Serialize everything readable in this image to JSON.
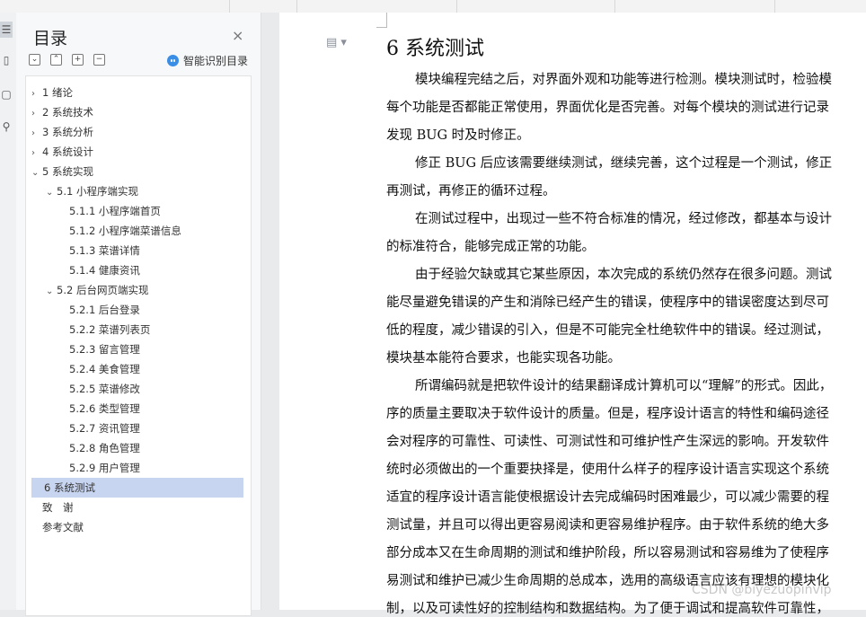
{
  "panel": {
    "title": "目录",
    "close_glyph": "×",
    "smart_label": "智能识别目录",
    "tools": [
      {
        "name": "collapse-all-button",
        "glyph": "⌄"
      },
      {
        "name": "expand-all-button",
        "glyph": "⌃"
      },
      {
        "name": "add-heading-button",
        "glyph": "+"
      },
      {
        "name": "remove-heading-button",
        "glyph": "−"
      }
    ]
  },
  "toc": [
    {
      "label": "1 绪论",
      "level": 0,
      "arrow": "›"
    },
    {
      "label": "2 系统技术",
      "level": 0,
      "arrow": "›"
    },
    {
      "label": "3 系统分析",
      "level": 0,
      "arrow": "›"
    },
    {
      "label": "4 系统设计",
      "level": 0,
      "arrow": "›"
    },
    {
      "label": "5 系统实现",
      "level": 0,
      "arrow": "⌄"
    },
    {
      "label": "5.1 小程序端实现",
      "level": 1,
      "arrow": "⌄"
    },
    {
      "label": "5.1.1 小程序端首页",
      "level": 2,
      "arrow": ""
    },
    {
      "label": "5.1.2 小程序端菜谱信息",
      "level": 2,
      "arrow": ""
    },
    {
      "label": "5.1.3 菜谱详情",
      "level": 2,
      "arrow": ""
    },
    {
      "label": "5.1.4 健康资讯",
      "level": 2,
      "arrow": ""
    },
    {
      "label": "5.2 后台网页端实现",
      "level": 1,
      "arrow": "⌄"
    },
    {
      "label": "5.2.1 后台登录",
      "level": 2,
      "arrow": ""
    },
    {
      "label": "5.2.2 菜谱列表页",
      "level": 2,
      "arrow": ""
    },
    {
      "label": "5.2.3 留言管理",
      "level": 2,
      "arrow": ""
    },
    {
      "label": "5.2.4 美食管理",
      "level": 2,
      "arrow": ""
    },
    {
      "label": "5.2.5 菜谱修改",
      "level": 2,
      "arrow": ""
    },
    {
      "label": "5.2.6 类型管理",
      "level": 2,
      "arrow": ""
    },
    {
      "label": "5.2.7 资讯管理",
      "level": 2,
      "arrow": ""
    },
    {
      "label": "5.2.8 角色管理",
      "level": 2,
      "arrow": ""
    },
    {
      "label": "5.2.9 用户管理",
      "level": 2,
      "arrow": ""
    },
    {
      "label": "6 系统测试",
      "level": 0,
      "arrow": "",
      "selected": true
    },
    {
      "label": "致　谢",
      "level": 0,
      "arrow": ""
    },
    {
      "label": "参考文献",
      "level": 0,
      "arrow": ""
    }
  ],
  "document": {
    "heading": "6 系统测试",
    "lines": [
      {
        "text": "模块编程完结之后，对界面外观和功能等进行检测。模块测试时，检验模",
        "indent": true
      },
      {
        "text": "每个功能是否都能正常使用，界面优化是否完善。对每个模块的测试进行记录",
        "indent": false
      },
      {
        "text": "发现 BUG 时及时修正。",
        "indent": false
      },
      {
        "text": "修正 BUG 后应该需要继续测试，继续完善，这个过程是一个测试，修正",
        "indent": true
      },
      {
        "text": "再测试，再修正的循环过程。",
        "indent": false
      },
      {
        "text": "在测试过程中，出现过一些不符合标准的情况，经过修改，都基本与设计",
        "indent": true
      },
      {
        "text": "的标准符合，能够完成正常的功能。",
        "indent": false
      },
      {
        "text": "由于经验欠缺或其它某些原因，本次完成的系统仍然存在很多问题。测试",
        "indent": true
      },
      {
        "text": "能尽量避免错误的产生和消除已经产生的错误，使程序中的错误密度达到尽可",
        "indent": false
      },
      {
        "text": "低的程度，减少错误的引入，但是不可能完全杜绝软件中的错误。经过测试，",
        "indent": false
      },
      {
        "text": "模块基本能符合要求，也能实现各功能。",
        "indent": false
      },
      {
        "text": "所谓编码就是把软件设计的结果翻译成计算机可以“理解”的形式。因此，",
        "indent": true
      },
      {
        "text": "序的质量主要取决于软件设计的质量。但是，程序设计语言的特性和编码途径",
        "indent": false
      },
      {
        "text": "会对程序的可靠性、可读性、可测试性和可维护性产生深远的影响。开发软件",
        "indent": false
      },
      {
        "text": "统时必须做出的一个重要抉择是，使用什么样子的程序设计语言实现这个系统",
        "indent": false
      },
      {
        "text": "适宜的程序设计语言能使根据设计去完成编码时困难最少，可以减少需要的程",
        "indent": false
      },
      {
        "text": "测试量，并且可以得出更容易阅读和更容易维护程序。由于软件系统的绝大多",
        "indent": false
      },
      {
        "text": "部分成本又在生命周期的测试和维护阶段，所以容易测试和容易维为了使程序",
        "indent": false
      },
      {
        "text": "易测试和维护已减少生命周期的总成本，选用的高级语言应该有理想的模块化",
        "indent": false
      },
      {
        "text": "制，以及可读性好的控制结构和数据结构。为了便于调试和提高软件可靠性，",
        "indent": false
      }
    ],
    "watermark": "CSDN @biyezuopinvip"
  }
}
